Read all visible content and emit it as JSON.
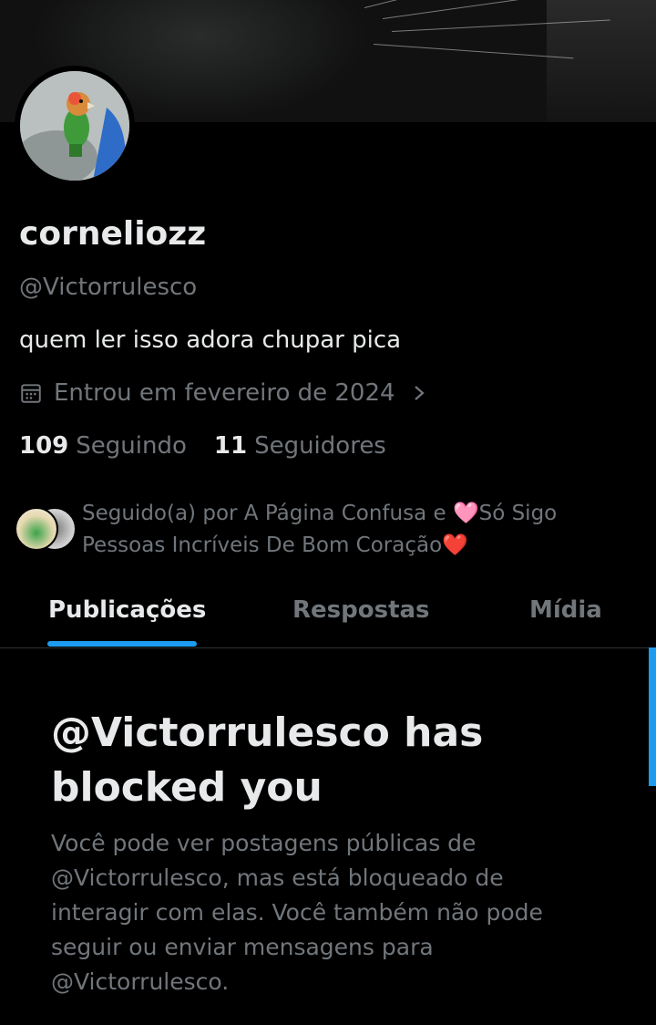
{
  "profile": {
    "display_name": "corneliozz",
    "handle": "@Victorrulesco",
    "bio": "quem ler isso adora chupar pica",
    "joined": "Entrou em fevereiro de 2024",
    "following_count": "109",
    "following_label": "Seguindo",
    "followers_count": "11",
    "followers_label": "Seguidores",
    "followed_by_line1": "Seguido(a) por A Página Confusa e 🩷Só Sigo",
    "followed_by_line2": "Pessoas Incríveis De Bom Coração❤️"
  },
  "tabs": [
    {
      "label": "Publicações",
      "active": true
    },
    {
      "label": "Respostas",
      "active": false
    },
    {
      "label": "Mídia",
      "active": false
    }
  ],
  "blocked": {
    "title": "@Victorrulesco has blocked you",
    "message": "Você pode ver postagens públicas de @Victorrulesco, mas está bloqueado de interagir com elas. Você também não pode seguir ou enviar mensagens para @Victorrulesco."
  },
  "colors": {
    "background": "#000000",
    "primary_text": "#e7e9ea",
    "secondary_text": "#71767b",
    "accent": "#1d9bf0",
    "divider": "#2f3336"
  },
  "icons": {
    "joined": "calendar-icon",
    "joined_more": "chevron-right-icon"
  }
}
